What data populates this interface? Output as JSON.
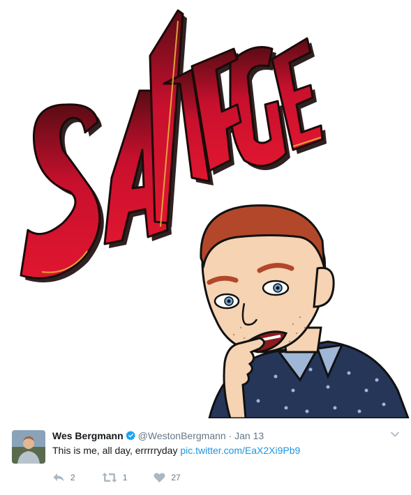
{
  "media": {
    "word": "SAVAGE",
    "colors": {
      "red": "#c8102e",
      "dark": "#1a0a0a",
      "gold": "#e3b33c",
      "skin": "#f5d3b3",
      "hair": "#b3472a",
      "shirt": "#253659"
    }
  },
  "tweet": {
    "author": {
      "name": "Wes Bergmann",
      "handle": "@WestonBergmann",
      "verified": true
    },
    "separator": "·",
    "timestamp": "Jan 13",
    "text": "This is me, all day, errrrryday",
    "link": "pic.twitter.com/EaX2Xi9Pb9",
    "actions": {
      "reply_count": "2",
      "retweet_count": "1",
      "like_count": "27"
    },
    "colors": {
      "link": "#1b95e0",
      "muted": "#657786",
      "verified": "#1da1f2"
    }
  }
}
